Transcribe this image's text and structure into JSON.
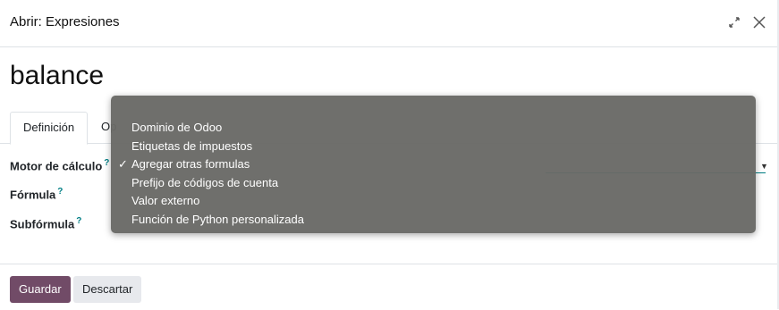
{
  "dialog": {
    "title": "Abrir: Expresiones"
  },
  "record": {
    "name": "balance"
  },
  "tabs": [
    {
      "label": "Definición",
      "active": true
    },
    {
      "label": "Op",
      "active": false
    }
  ],
  "fields": {
    "engine_label": "Motor de cálculo",
    "formula_label": "Fórmula",
    "subformula_label": "Subfórmula",
    "help_mark": "?"
  },
  "dropdown": {
    "items": [
      {
        "label": "Dominio de Odoo",
        "selected": false
      },
      {
        "label": "Etiquetas de impuestos",
        "selected": false
      },
      {
        "label": "Agregar otras formulas",
        "selected": true
      },
      {
        "label": "Prefijo de códigos de cuenta",
        "selected": false
      },
      {
        "label": "Valor externo",
        "selected": false
      },
      {
        "label": "Función de Python personalizada",
        "selected": false
      }
    ],
    "check_mark": "✓"
  },
  "footer": {
    "save_label": "Guardar",
    "discard_label": "Descartar"
  },
  "colors": {
    "primary": "#714b67",
    "accent": "#017e84",
    "dropdown_bg": "#696966"
  }
}
